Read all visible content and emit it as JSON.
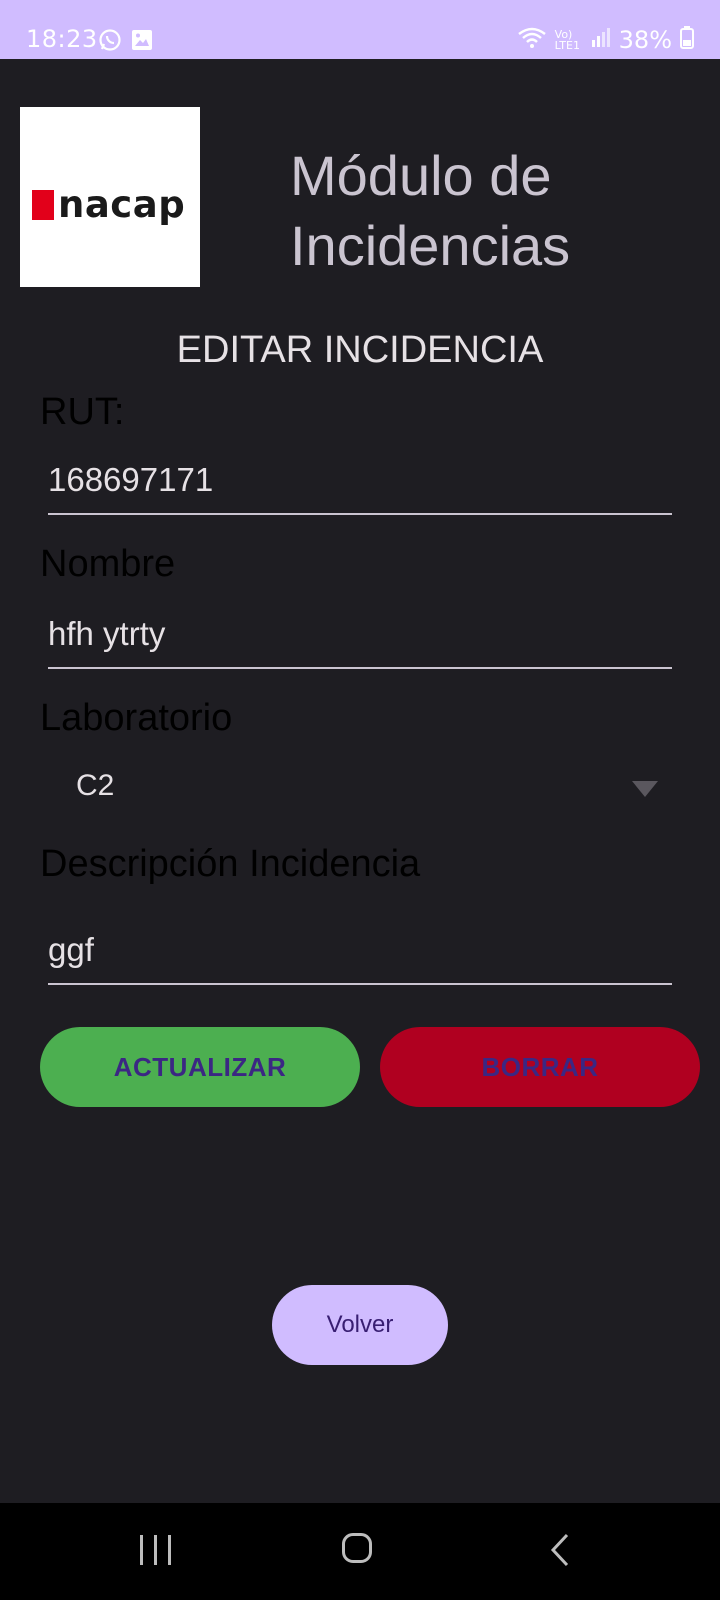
{
  "status_bar": {
    "time": "18:23",
    "battery": "38%",
    "network": "Vo) LTE1",
    "icons": [
      "whatsapp-icon",
      "image-icon",
      "wifi-icon",
      "signal-icon",
      "battery-icon"
    ]
  },
  "header": {
    "logo_text": "nacap",
    "title": "Módulo de Incidencias"
  },
  "form": {
    "heading": "EDITAR INCIDENCIA",
    "rut_label": "RUT:",
    "rut_value": "168697171",
    "name_label": "Nombre",
    "name_value": "hfh ytrty",
    "lab_label": "Laboratorio",
    "lab_selected": "C2",
    "description_label": "Descripción Incidencia",
    "description_value": "ggf"
  },
  "buttons": {
    "update": "ACTUALIZAR",
    "delete": "BORRAR",
    "back": "Volver"
  },
  "colors": {
    "status_bar": "#d0bcff",
    "background": "#1e1d22",
    "update_button": "#4caf50",
    "delete_button": "#b00020",
    "back_button": "#d0bcff",
    "logo_red": "#e2001a"
  }
}
